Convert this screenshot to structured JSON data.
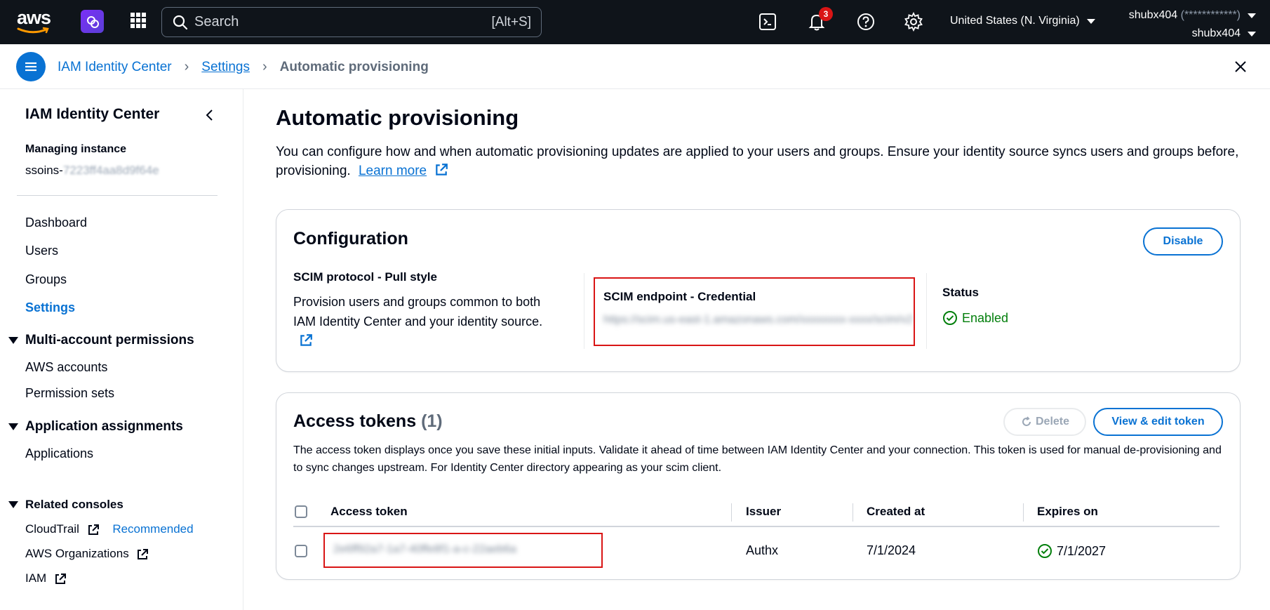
{
  "topnav": {
    "logo_text": "aws",
    "search_placeholder": "Search",
    "search_shortcut": "[Alt+S]",
    "notifications_count": "3",
    "region": "United States (N. Virginia)",
    "account_name": "shubx404",
    "account_id_masked": "(************)",
    "user_name": "shubx404"
  },
  "breadcrumb": {
    "items": [
      "IAM Identity Center",
      "Settings",
      "Automatic provisioning"
    ]
  },
  "sidebar": {
    "title": "IAM Identity Center",
    "managing_label": "Managing instance",
    "managing_prefix": "ssoins-",
    "managing_masked": "7223ff4aa8d9f64e",
    "links": [
      "Dashboard",
      "Users",
      "Groups",
      "Settings"
    ],
    "section_multi": "Multi-account permissions",
    "multi_links": [
      "AWS accounts",
      "Permission sets"
    ],
    "section_app": "Application assignments",
    "app_links": [
      "Applications"
    ],
    "section_related": "Related consoles",
    "related": [
      "CloudTrail",
      "AWS Organizations",
      "IAM"
    ],
    "recommended": "Recommended"
  },
  "main": {
    "title": "Automatic provisioning",
    "description": "You can configure how and when automatic provisioning updates are applied to your users and groups. Ensure your identity source syncs users and groups before, provisioning.",
    "learn_more": "Learn more"
  },
  "configuration": {
    "title": "Configuration",
    "disable_button": "Disable",
    "protocol_title": "SCIM protocol - Pull style",
    "protocol_desc": "Provision users and groups common to both IAM Identity Center and your identity source.",
    "endpoint_label": "SCIM endpoint - Credential",
    "endpoint_value": "https://scim.us-east-1.amazonaws.com/xxxxxxxx-xxxx/scim/v2",
    "status_label": "Status",
    "status_value": "Enabled"
  },
  "tokens": {
    "title": "Access tokens",
    "count": "(1)",
    "delete_button": "Delete",
    "view_edit_button": "View & edit token",
    "description": "The access token displays once you save these initial inputs. Validate it ahead of time between IAM Identity Center and your connection. This token is used for manual de-provisioning and to sync changes upstream. For Identity Center directory appearing as your scim client.",
    "columns": [
      "Access token",
      "Issuer",
      "Created at",
      "Expires on"
    ],
    "rows": [
      {
        "token": "2e6ff92a7-1a7-40ffe8f1-a-c-22aeb6a",
        "issuer": "Authx",
        "created": "7/1/2024",
        "expires": "7/1/2027"
      }
    ]
  },
  "colors": {
    "accent": "#0972d3",
    "nav_bg": "#0f141a",
    "success": "#037f0c",
    "highlight": "#d91515"
  }
}
